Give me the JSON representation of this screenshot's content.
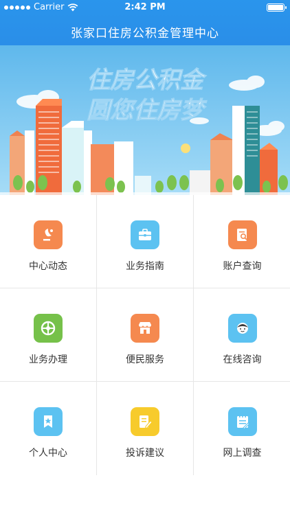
{
  "status_bar": {
    "carrier": "Carrier",
    "time": "2:42 PM"
  },
  "header": {
    "title": "张家口住房公积金管理中心"
  },
  "banner": {
    "line1": "住房公积金",
    "line2": "圆您住房梦"
  },
  "menu": [
    {
      "label": "中心动态",
      "icon": "satellite-dish-icon",
      "color": "#f5894f"
    },
    {
      "label": "业务指南",
      "icon": "briefcase-icon",
      "color": "#5cc2f1"
    },
    {
      "label": "账户查询",
      "icon": "document-search-icon",
      "color": "#f5894f"
    },
    {
      "label": "业务办理",
      "icon": "target-icon",
      "color": "#76c14a"
    },
    {
      "label": "便民服务",
      "icon": "shop-icon",
      "color": "#f5894f"
    },
    {
      "label": "在线咨询",
      "icon": "service-agent-icon",
      "color": "#5cc2f1"
    },
    {
      "label": "个人中心",
      "icon": "bookmark-star-icon",
      "color": "#5cc2f1"
    },
    {
      "label": "投诉建议",
      "icon": "edit-note-icon",
      "color": "#f7cb2c"
    },
    {
      "label": "网上调查",
      "icon": "notepad-icon",
      "color": "#5cc2f1"
    }
  ]
}
